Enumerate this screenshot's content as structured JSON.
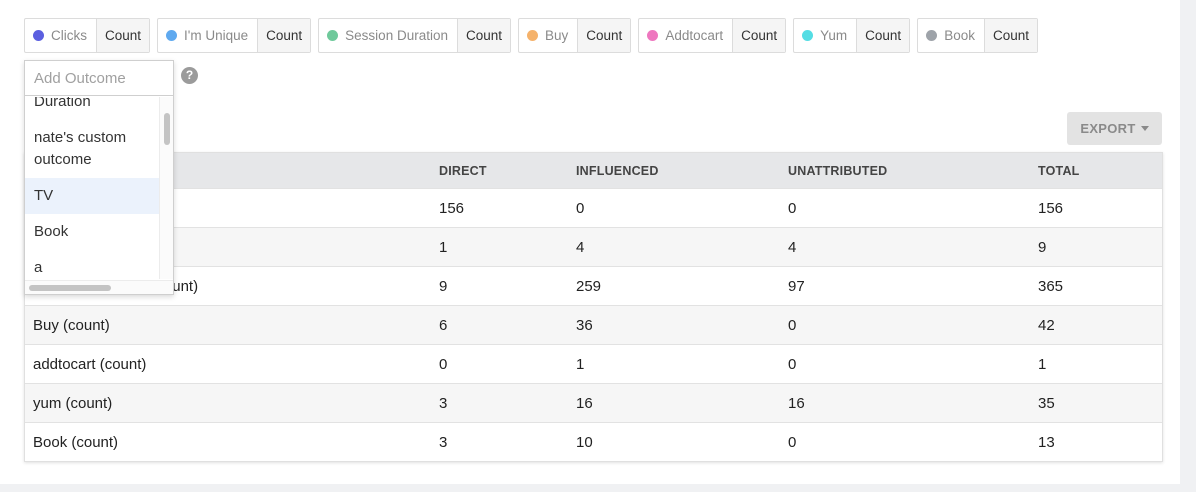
{
  "chips": [
    {
      "name": "Clicks",
      "aggregation": "Count",
      "color": "#5b5fe0"
    },
    {
      "name": "I'm Unique",
      "aggregation": "Count",
      "color": "#5fa9ef"
    },
    {
      "name": "Session Duration",
      "aggregation": "Count",
      "color": "#6fc99b"
    },
    {
      "name": "Buy",
      "aggregation": "Count",
      "color": "#f5b26b"
    },
    {
      "name": "Addtocart",
      "aggregation": "Count",
      "color": "#ee77bf"
    },
    {
      "name": "Yum",
      "aggregation": "Count",
      "color": "#54dde4"
    },
    {
      "name": "Book",
      "aggregation": "Count",
      "color": "#9ea3a9"
    }
  ],
  "add_outcome": {
    "placeholder": "Add Outcome",
    "help_glyph": "?",
    "options": [
      "Duration",
      "nate's custom outcome",
      "TV",
      "Book",
      "a"
    ],
    "highlighted_option": "TV"
  },
  "export": {
    "label": "EXPORT"
  },
  "table": {
    "headers": [
      "",
      "DIRECT",
      "INFLUENCED",
      "UNATTRIBUTED",
      "TOTAL"
    ],
    "rows": [
      {
        "label": "",
        "direct": "156",
        "influenced": "0",
        "unattributed": "0",
        "total": "156"
      },
      {
        "label": "",
        "direct": "1",
        "influenced": "4",
        "unattributed": "4",
        "total": "9"
      },
      {
        "label": "Session Duration (count)",
        "direct": "9",
        "influenced": "259",
        "unattributed": "97",
        "total": "365"
      },
      {
        "label": "Buy (count)",
        "direct": "6",
        "influenced": "36",
        "unattributed": "0",
        "total": "42"
      },
      {
        "label": "addtocart (count)",
        "direct": "0",
        "influenced": "1",
        "unattributed": "0",
        "total": "1"
      },
      {
        "label": "yum (count)",
        "direct": "3",
        "influenced": "16",
        "unattributed": "16",
        "total": "35"
      },
      {
        "label": "Book (count)",
        "direct": "3",
        "influenced": "10",
        "unattributed": "0",
        "total": "13"
      }
    ]
  }
}
